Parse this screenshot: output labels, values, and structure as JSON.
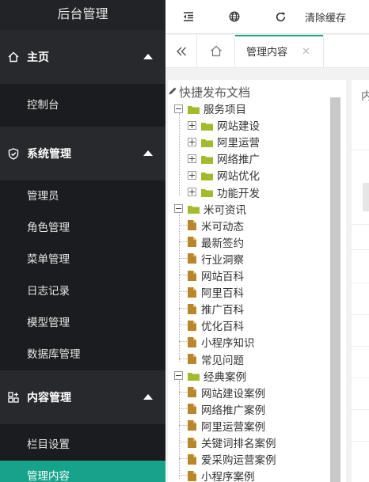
{
  "sidebar": {
    "brand": "后台管理",
    "groups": [
      {
        "label": "主页",
        "icon": "home-icon",
        "items": [
          "控制台"
        ]
      },
      {
        "label": "系统管理",
        "icon": "shield-icon",
        "items": [
          "管理员",
          "角色管理",
          "菜单管理",
          "日志记录",
          "模型管理",
          "数据库管理"
        ]
      },
      {
        "label": "内容管理",
        "icon": "grid-icon",
        "items": [
          "栏目设置",
          "管理内容"
        ]
      }
    ],
    "active_item": "管理内容"
  },
  "topbar": {
    "icons": [
      "indent-icon",
      "globe-icon",
      "refresh-icon"
    ],
    "clear_cache": "清除缓存"
  },
  "tabs": {
    "active_label": "管理内容",
    "close_icon": "close-icon"
  },
  "tree": {
    "title": "快捷发布文档",
    "nodes": [
      {
        "label": "服务项目",
        "type": "folder",
        "expanded": true,
        "children": [
          {
            "label": "网站建设",
            "type": "folder"
          },
          {
            "label": "阿里运营",
            "type": "folder"
          },
          {
            "label": "网络推广",
            "type": "folder"
          },
          {
            "label": "网站优化",
            "type": "folder"
          },
          {
            "label": "功能开发",
            "type": "folder"
          }
        ]
      },
      {
        "label": "米可资讯",
        "type": "folder",
        "expanded": true,
        "children": [
          {
            "label": "米可动态",
            "type": "doc"
          },
          {
            "label": "最新签约",
            "type": "doc"
          },
          {
            "label": "行业洞察",
            "type": "doc"
          },
          {
            "label": "网站百科",
            "type": "doc"
          },
          {
            "label": "阿里百科",
            "type": "doc"
          },
          {
            "label": "推广百科",
            "type": "doc"
          },
          {
            "label": "优化百科",
            "type": "doc"
          },
          {
            "label": "小程序知识",
            "type": "doc"
          },
          {
            "label": "常见问题",
            "type": "doc"
          }
        ]
      },
      {
        "label": "经典案例",
        "type": "folder",
        "expanded": true,
        "children": [
          {
            "label": "网站建设案例",
            "type": "doc"
          },
          {
            "label": "网络推广案例",
            "type": "doc"
          },
          {
            "label": "阿里运营案例",
            "type": "doc"
          },
          {
            "label": "关键词排名案例",
            "type": "doc"
          },
          {
            "label": "爱采购运营案例",
            "type": "doc"
          },
          {
            "label": "小程序案例",
            "type": "doc"
          }
        ]
      }
    ]
  },
  "right_panel": {
    "partial_text": "内"
  },
  "colors": {
    "accent": "#16a28b",
    "sidebar_bg": "#28292d",
    "folder": "#a5b92c",
    "doc": "#b8862b"
  }
}
